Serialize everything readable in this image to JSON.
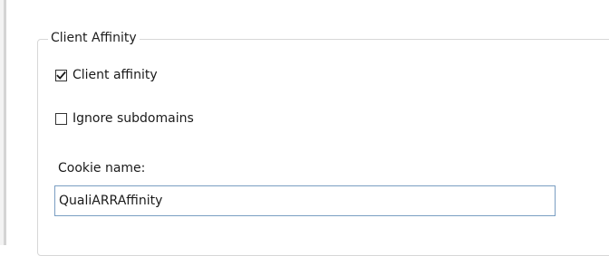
{
  "group": {
    "title": "Client Affinity"
  },
  "client_affinity": {
    "label": "Client affinity",
    "checked": true
  },
  "ignore_subdomains": {
    "label": "Ignore subdomains",
    "checked": false
  },
  "cookie_name": {
    "label": "Cookie name:",
    "value": "QualiARRAffinity"
  },
  "icons": {
    "checkmark": "checkmark-icon"
  }
}
